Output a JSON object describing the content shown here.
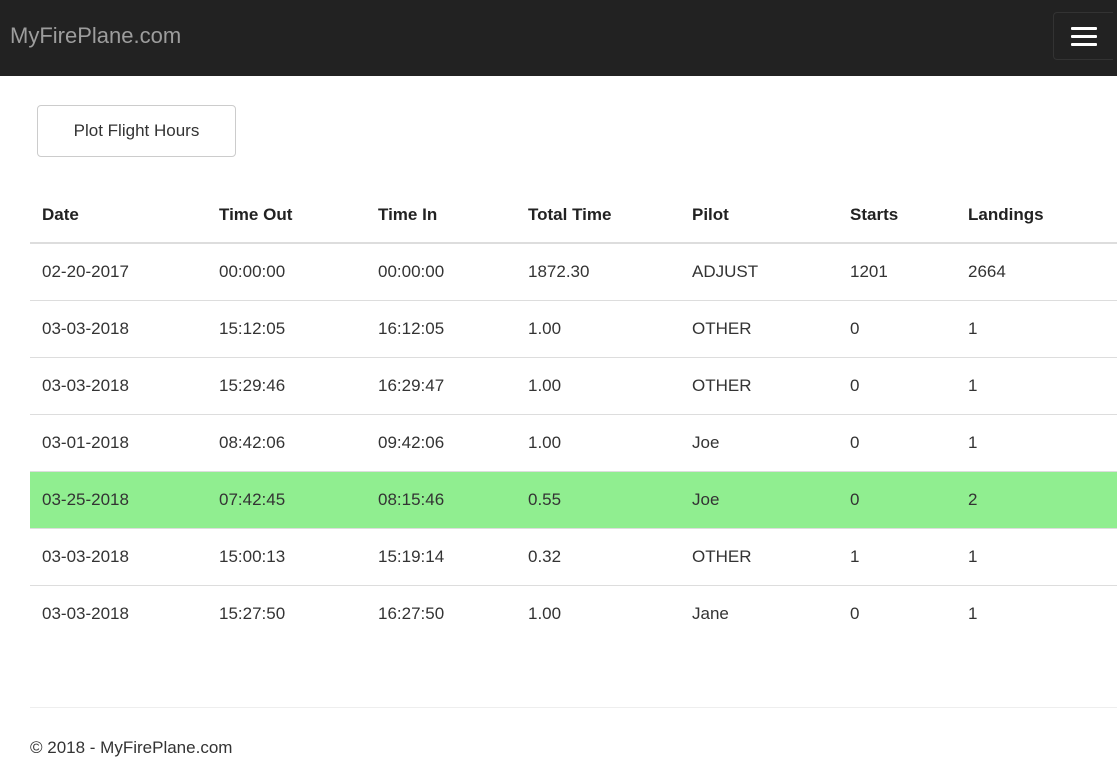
{
  "navbar": {
    "brand": "MyFirePlane.com",
    "toggle_icon": "hamburger-menu-icon"
  },
  "actions": {
    "plot_button_label": "Plot Flight Hours"
  },
  "table": {
    "headers": [
      "Date",
      "Time Out",
      "Time In",
      "Total Time",
      "Pilot",
      "Starts",
      "Landings"
    ],
    "rows": [
      [
        "02-20-2017",
        "00:00:00",
        "00:00:00",
        "1872.30",
        "ADJUST",
        "1201",
        "2664"
      ],
      [
        "03-03-2018",
        "15:12:05",
        "16:12:05",
        "1.00",
        "OTHER",
        "0",
        "1"
      ],
      [
        "03-03-2018",
        "15:29:46",
        "16:29:47",
        "1.00",
        "OTHER",
        "0",
        "1"
      ],
      [
        "03-01-2018",
        "08:42:06",
        "09:42:06",
        "1.00",
        "Joe",
        "0",
        "1"
      ],
      [
        "03-25-2018",
        "07:42:45",
        "08:15:46",
        "0.55",
        "Joe",
        "0",
        "2"
      ],
      [
        "03-03-2018",
        "15:00:13",
        "15:19:14",
        "0.32",
        "OTHER",
        "1",
        "1"
      ],
      [
        "03-03-2018",
        "15:27:50",
        "16:27:50",
        "1.00",
        "Jane",
        "0",
        "1"
      ]
    ],
    "highlight_row_color": "#90ee90"
  },
  "footer": {
    "text": "© 2018 - MyFirePlane.com"
  },
  "colors": {
    "navbar_bg": "#222222",
    "brand_text": "#9d9d9d"
  }
}
